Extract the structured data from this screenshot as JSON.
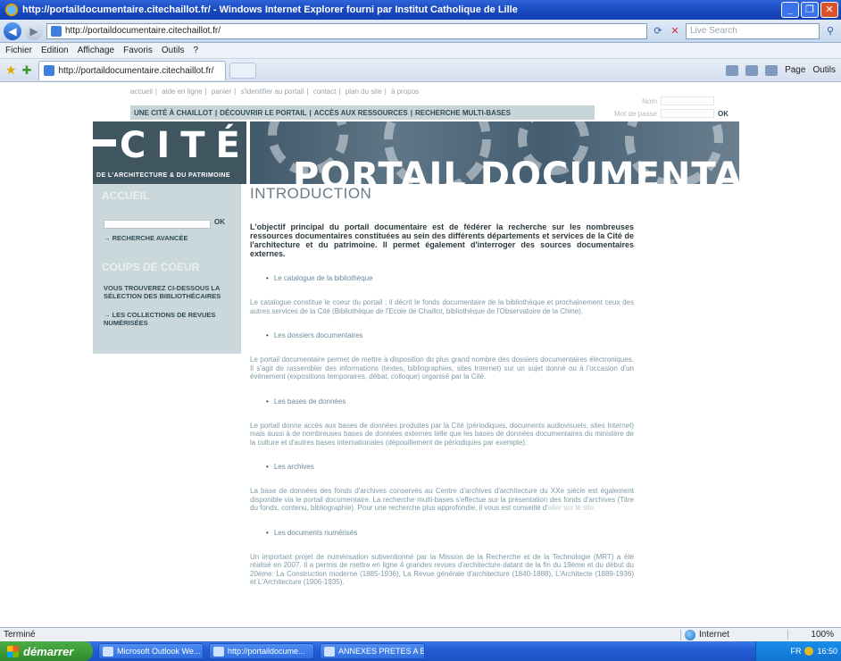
{
  "window": {
    "title": "http://portaildocumentaire.citechaillot.fr/ - Windows Internet Explorer fourni par Institut Catholique de Lille",
    "url": "http://portaildocumentaire.citechaillot.fr/",
    "search_placeholder": "Live Search"
  },
  "menu": [
    "Fichier",
    "Edition",
    "Affichage",
    "Favoris",
    "Outils",
    "?"
  ],
  "tab": {
    "label": "http://portaildocumentaire.citechaillot.fr/"
  },
  "commands": {
    "page": "Page",
    "tools": "Outils"
  },
  "site": {
    "top_links": [
      "accueil",
      "aide en ligne",
      "panier",
      "s'identifier au portail",
      "contact",
      "plan du site",
      "à propos"
    ],
    "nav": [
      "UNE CITÉ À CHAILLOT",
      "DÉCOUVRIR LE PORTAIL",
      "ACCÈS AUX RESSOURCES",
      "RECHERCHE MULTI-BASES"
    ],
    "login": {
      "user_label": "Nom",
      "password_label": "Mot de passe",
      "ok": "OK"
    },
    "logo": {
      "word": "CITÉ",
      "subtitle": "DE L'ARCHITECTURE & DU PATRIMOINE"
    },
    "banner_title": "PORTAIL DOCUMENTAIRE",
    "sidebar": {
      "accueil": "ACCUEIL",
      "search_ok": "OK",
      "advanced": "→ RECHERCHE AVANCÉE",
      "coups_de_coeur": "COUPS DE COEUR",
      "selection": "VOUS TROUVEREZ CI-DESSOUS LA SÉLECTION DES BIBLIOTHÉCAIRES",
      "collections": "→ LES COLLECTIONS DE REVUES NUMÉRISÉES"
    }
  },
  "content": {
    "title": "INTRODUCTION",
    "intro": "L'objectif principal du portail documentaire est de fédérer la recherche sur les nombreuses ressources documentaires constituées au sein des différents départements et services de la Cité de l'architecture et du patrimoine. Il permet également d'interroger des sources documentaires externes.",
    "sections": [
      {
        "heading": "Le catalogue de la bibliothèque",
        "text": "Le catalogue constitue le coeur du portail ; il décrit le fonds documentaire de la bibliothèque et prochainement ceux des autres services de la Cité (Bibliothèque de l'Ecole de Chaillot, bibliothèque de l'Observatoire de la Chine)."
      },
      {
        "heading": "Les dossiers documentaires",
        "text": "Le portail documentaire permet de mettre à disposition du plus grand nombre des dossiers documentaires électroniques. Il s'agit de rassembler des informations (textes, bibliographies, sites Internet) sur un sujet donné ou à l'occasion d'un événement (expositions temporaires, débat, colloque) organisé par la Cité."
      },
      {
        "heading": "Les bases de données",
        "text": "Le portail donne accès aux bases de données produites par la Cité (périodiques, documents audiovisuels, sites Internet) mais aussi à de nombreuses bases de données externes telle que les bases de données documentaires du ministère de la culture et d'autres bases internationales (dépouillement de périodiques par exemple)."
      },
      {
        "heading": "Les archives",
        "text": "La base de données des fonds d'archives conservés au Centre d'archives d'architecture du XXe siècle est également disponible via le portail documentaire. La recherche multi-bases s'effectue sur la présentation des fonds d'archives (Titre du fonds, contenu, bibliographie). Pour une recherche plus approfondie, il vous est conseillé d'",
        "link": "aller sur le site."
      },
      {
        "heading": "Les documents numérisés",
        "text": "Un important projet de numérisation subventionné par la Mission de la Recherche et de la Technologie (MRT) a été réalisé en 2007. Il a permis de mettre en ligne 4 grandes revues d'architecture datant de la fin du 19ème et du début du 20ème: La Construction moderne (1885-1936), La Revue générale d'architecture (1840-1888), L'Architecte (1889-1936) et L'Architecture (1906-1935)."
      }
    ]
  },
  "status": {
    "text": "Terminé",
    "zone": "Internet",
    "zoom": "100%"
  },
  "taskbar": {
    "start": "démarrer",
    "tasks": [
      "Microsoft Outlook We...",
      "http://portaildocume...",
      "ANNEXES PRETES A E..."
    ],
    "tray": "FR",
    "clock": "16:50"
  },
  "colors": {
    "sidebar": "#cad7db",
    "navbar": "#c7d5d9",
    "logo_bg": "#3f5661",
    "xp_blue": "#245ed6"
  }
}
